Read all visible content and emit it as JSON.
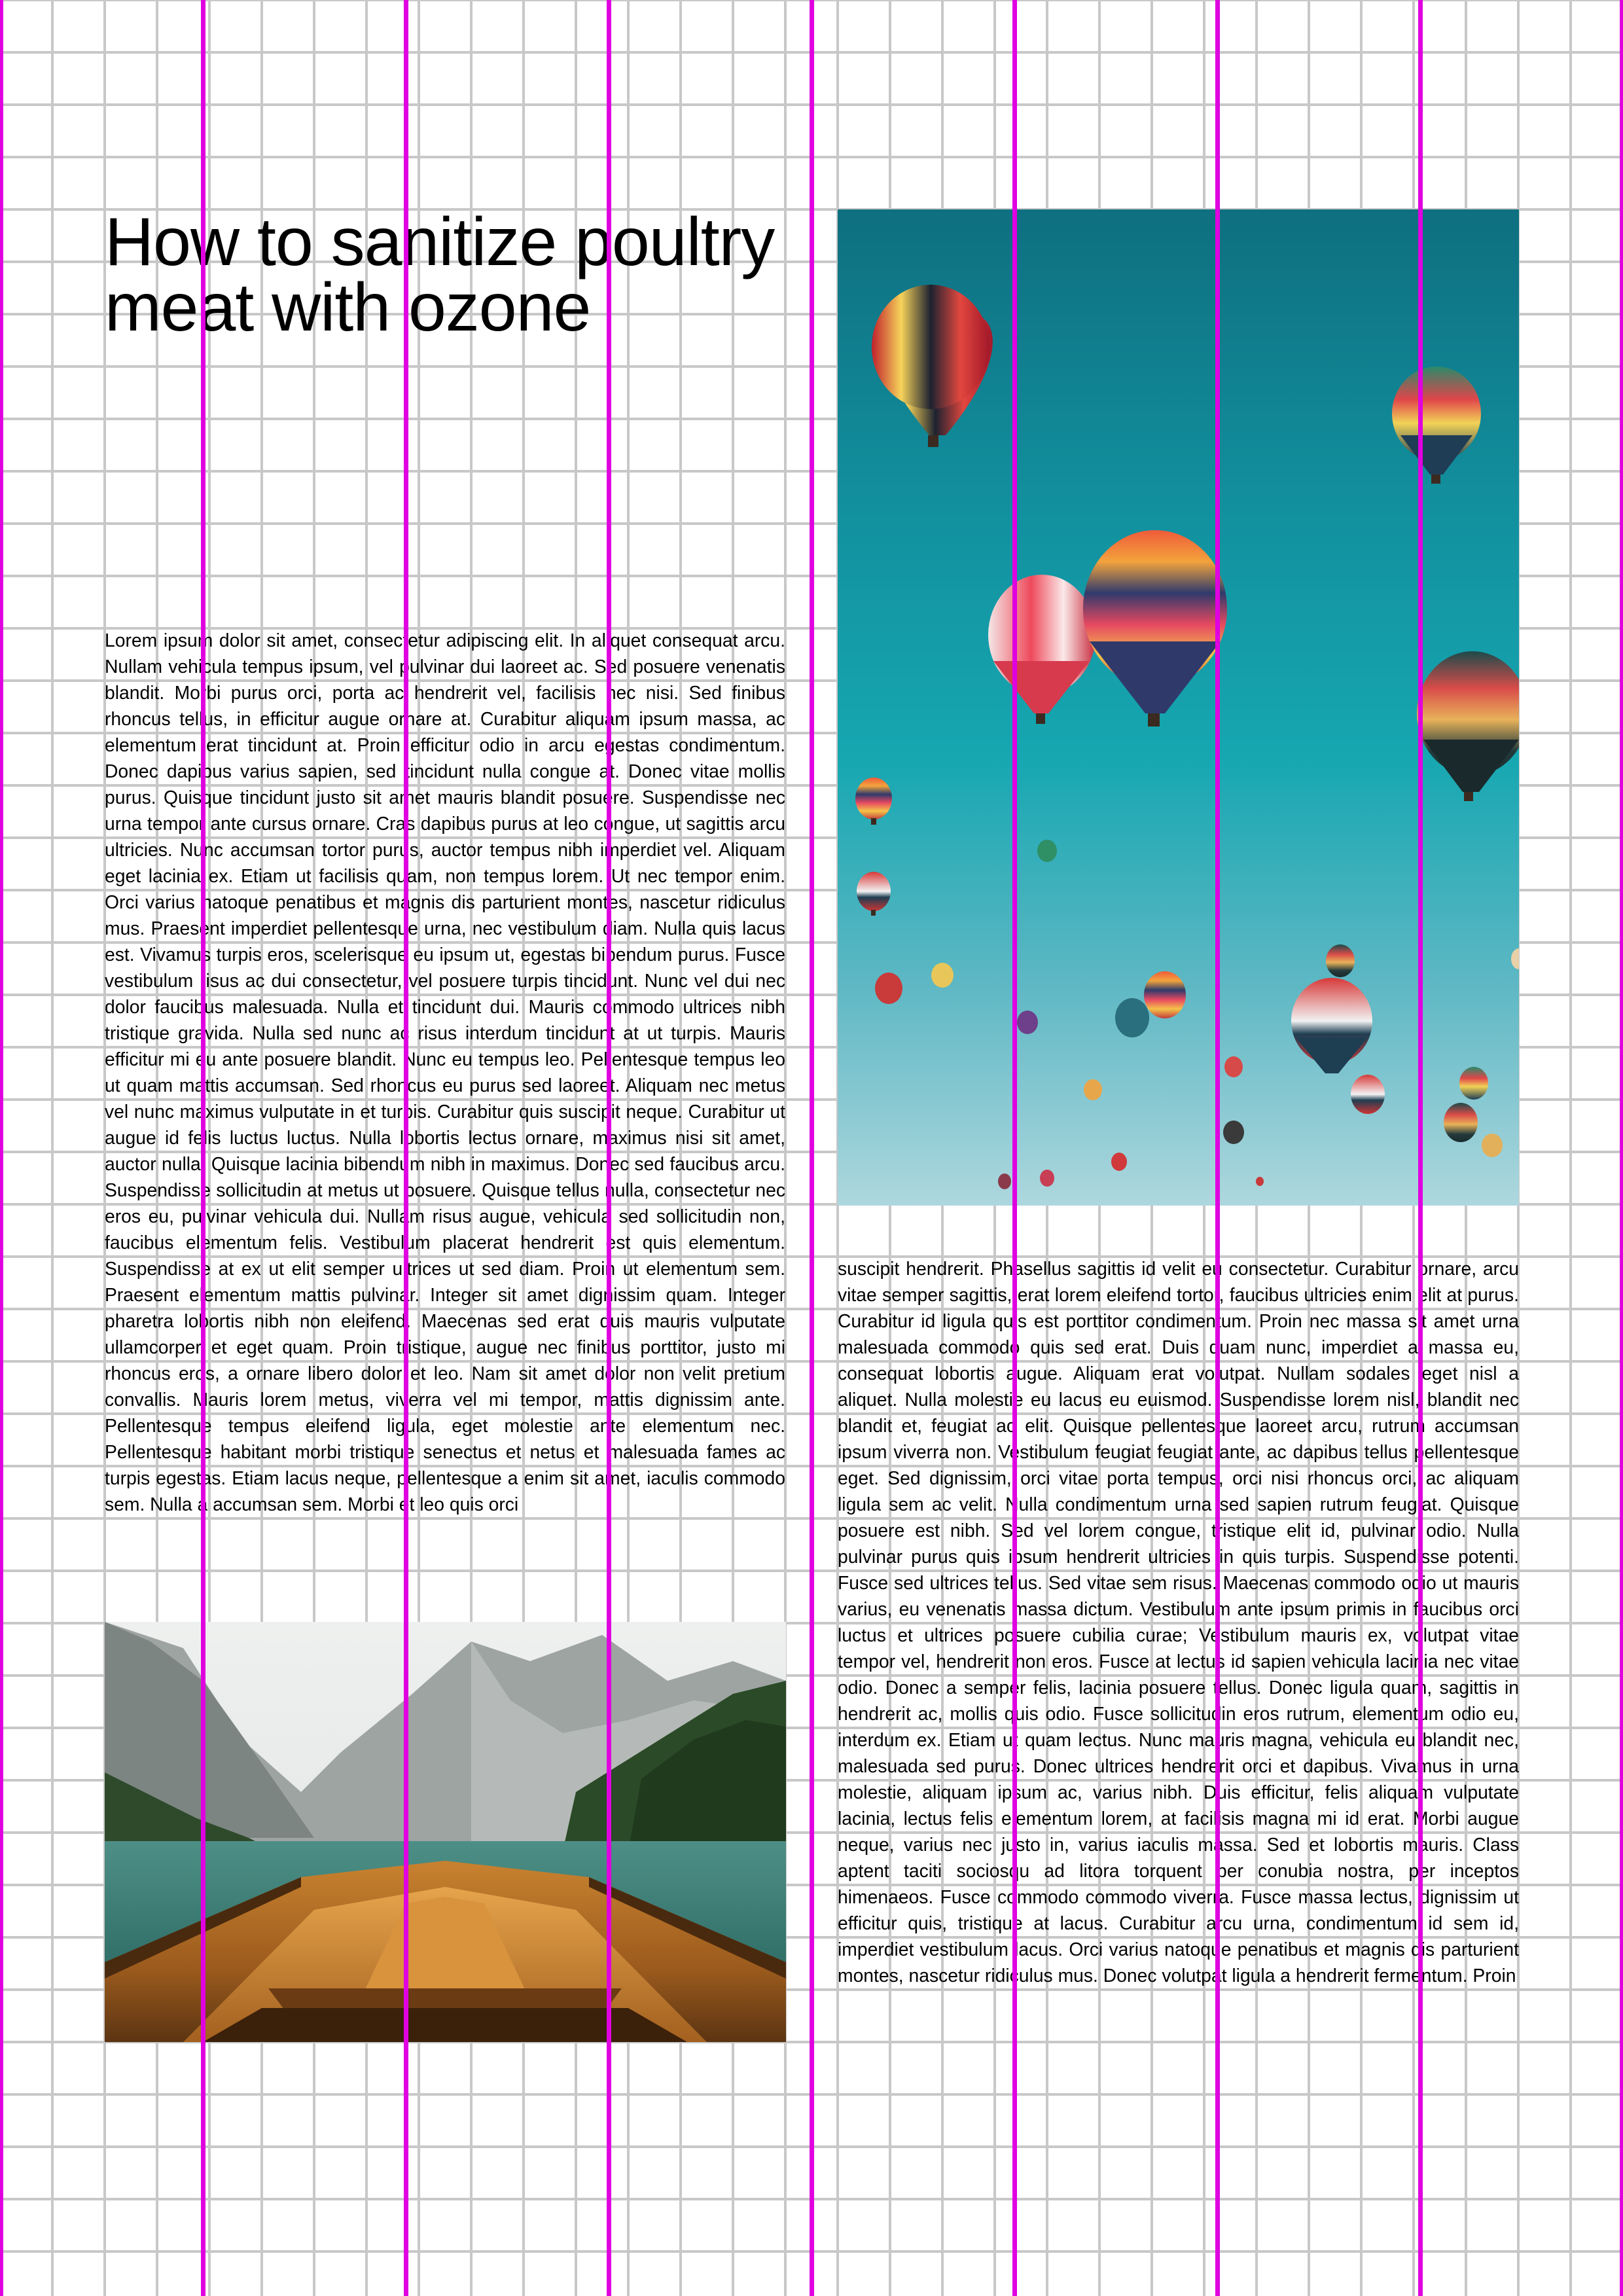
{
  "article": {
    "title": "How to sanitize poultry meat with ozone",
    "column_left_text": "Lorem ipsum dolor sit amet, consectetur adipiscing elit. In aliquet consequat arcu. Nullam vehicula tempus ipsum, vel pulvinar dui laoreet ac. Sed posuere venenatis blandit. Morbi purus orci, porta ac hendrerit vel, facilisis nec nisi. Sed finibus rhoncus tellus, in efficitur augue ornare at. Curabitur aliquam ipsum massa, ac elementum erat tincidunt at. Proin efficitur odio in arcu egestas condimentum. Donec dapibus varius sapien, sed tincidunt nulla congue at. Donec vitae mollis purus. Quisque tincidunt justo sit amet mauris blandit posuere. Suspendisse nec urna tempor ante cursus ornare. Cras dapibus purus at leo congue, ut sagittis arcu ultricies. Nunc accumsan tortor purus, auctor tempus nibh imperdiet vel. Aliquam eget lacinia ex. Etiam ut facilisis quam, non tempus lorem.  Ut nec tempor enim. Orci varius natoque penatibus et magnis dis parturient montes, nascetur ridiculus mus. Praesent imperdiet pellentesque urna, nec vestibulum diam. Nulla quis lacus est. Vivamus turpis eros, scelerisque eu ipsum ut, egestas bibendum purus. Fusce vestibulum risus ac dui consectetur, vel posuere turpis tincidunt. Nunc vel dui nec dolor faucibus malesuada. Nulla et tincidunt dui. Mauris commodo ultrices nibh tristique gravida. Nulla sed nunc ac risus interdum tincidunt at ut turpis.  Mauris efficitur mi eu ante posuere blandit. Nunc eu tempus leo. Pellentesque tempus leo ut quam mattis accumsan. Sed rhoncus eu purus sed laoreet. Aliquam nec metus vel nunc maximus vulputate in et turpis. Curabitur quis suscipit neque. Curabitur ut augue id felis luctus luctus. Nulla lobortis lectus ornare, maximus nisi sit amet, auctor nulla.  Quisque lacinia bibendum nibh in maximus. Donec sed faucibus arcu. Suspendisse sollicitudin at metus ut posuere. Quisque tellus nulla, consectetur nec eros eu, pulvinar vehicula dui. Nullam risus augue, vehicula sed sollicitudin non, faucibus elementum felis. Vestibulum placerat hendrerit est quis elementum. Suspendisse at ex ut elit semper ultrices ut sed diam. Proin ut elementum sem. Praesent elementum mattis pulvinar. Integer sit amet dignissim quam. Integer pharetra lobortis nibh non eleifend. Maecenas sed erat quis mauris vulputate ullamcorper et eget quam.  Proin tristique, augue nec finibus porttitor, justo mi rhoncus eros, a ornare libero dolor et leo. Nam sit amet dolor non velit pretium convallis. Mauris lorem metus, viverra vel mi tempor, mattis dignissim ante. Pellentesque tempus eleifend ligula, eget molestie ante elementum nec. Pellentesque habitant morbi tristique senectus et netus et malesuada fames ac turpis egestas. Etiam lacus neque, pellentesque a enim sit amet, iaculis commodo sem. Nulla a accumsan sem. Morbi et leo quis orci",
    "column_right_text": "suscipit hendrerit. Phasellus sagittis id velit eu consectetur. Curabitur ornare, arcu vitae semper sagittis, erat lorem eleifend tortor, faucibus ultricies enim elit at purus. Curabitur id ligula quis est porttitor condimentum.  Proin nec massa sit amet urna malesuada commodo quis sed erat. Duis quam nunc, imperdiet a massa eu, consequat lobortis augue. Aliquam erat volutpat. Nullam sodales eget nisl a aliquet. Nulla molestie eu lacus eu euismod. Suspendisse lorem nisl, blandit nec blandit et, feugiat ac elit. Quisque pellentesque laoreet arcu, rutrum accumsan ipsum viverra non.  Vestibulum feugiat feugiat ante, ac dapibus tellus pellentesque eget. Sed dignissim, orci vitae porta tempus, orci nisi rhoncus orci, ac aliquam ligula sem ac velit. Nulla condimentum urna sed sapien rutrum feugiat. Quisque posuere est nibh. Sed vel lorem congue, tristique elit id, pulvinar odio. Nulla pulvinar purus quis ipsum hendrerit ultricies in quis turpis. Suspendisse potenti. Fusce sed ultrices tellus. Sed vitae sem risus. Maecenas commodo odio ut mauris varius, eu venenatis massa dictum. Vestibulum ante ipsum primis in faucibus orci luctus et ultrices posuere cubilia curae; Vestibulum mauris ex, volutpat vitae tempor vel, hendrerit non eros. Fusce at lectus id sapien vehicula lacinia nec vitae odio. Donec a semper felis, lacinia posuere tellus.  Donec ligula quam, sagittis in hendrerit ac, mollis quis odio. Fusce sollicitudin eros rutrum, elementum odio eu, interdum ex. Etiam ut quam lectus. Nunc mauris magna, vehicula eu blandit nec, malesuada sed purus. Donec ultrices hendrerit orci et dapibus. Vivamus in urna molestie, aliquam ipsum ac, varius nibh. Duis efficitur, felis aliquam vulputate lacinia, lectus felis elementum lorem, at facilisis magna mi id erat. Morbi augue neque, varius nec justo in, varius iaculis massa. Sed et lobortis mauris. Class aptent taciti sociosqu ad litora torquent per conubia nostra, per inceptos himenaeos. Fusce commodo commodo viverra. Fusce massa lectus, dignissim ut efficitur quis, tristique at lacus. Curabitur arcu urna, condimentum id sem id, imperdiet vestibulum lacus.  Orci varius natoque penatibus et magnis dis parturient montes, nascetur ridiculus mus. Donec volutpat ligula a hendrerit fermentum. Proin"
  },
  "colors": {
    "grid": "#c8c8c8",
    "guide": "#e000e0",
    "sky_top": "#0e6f80",
    "sky_bottom": "#aed7de"
  }
}
